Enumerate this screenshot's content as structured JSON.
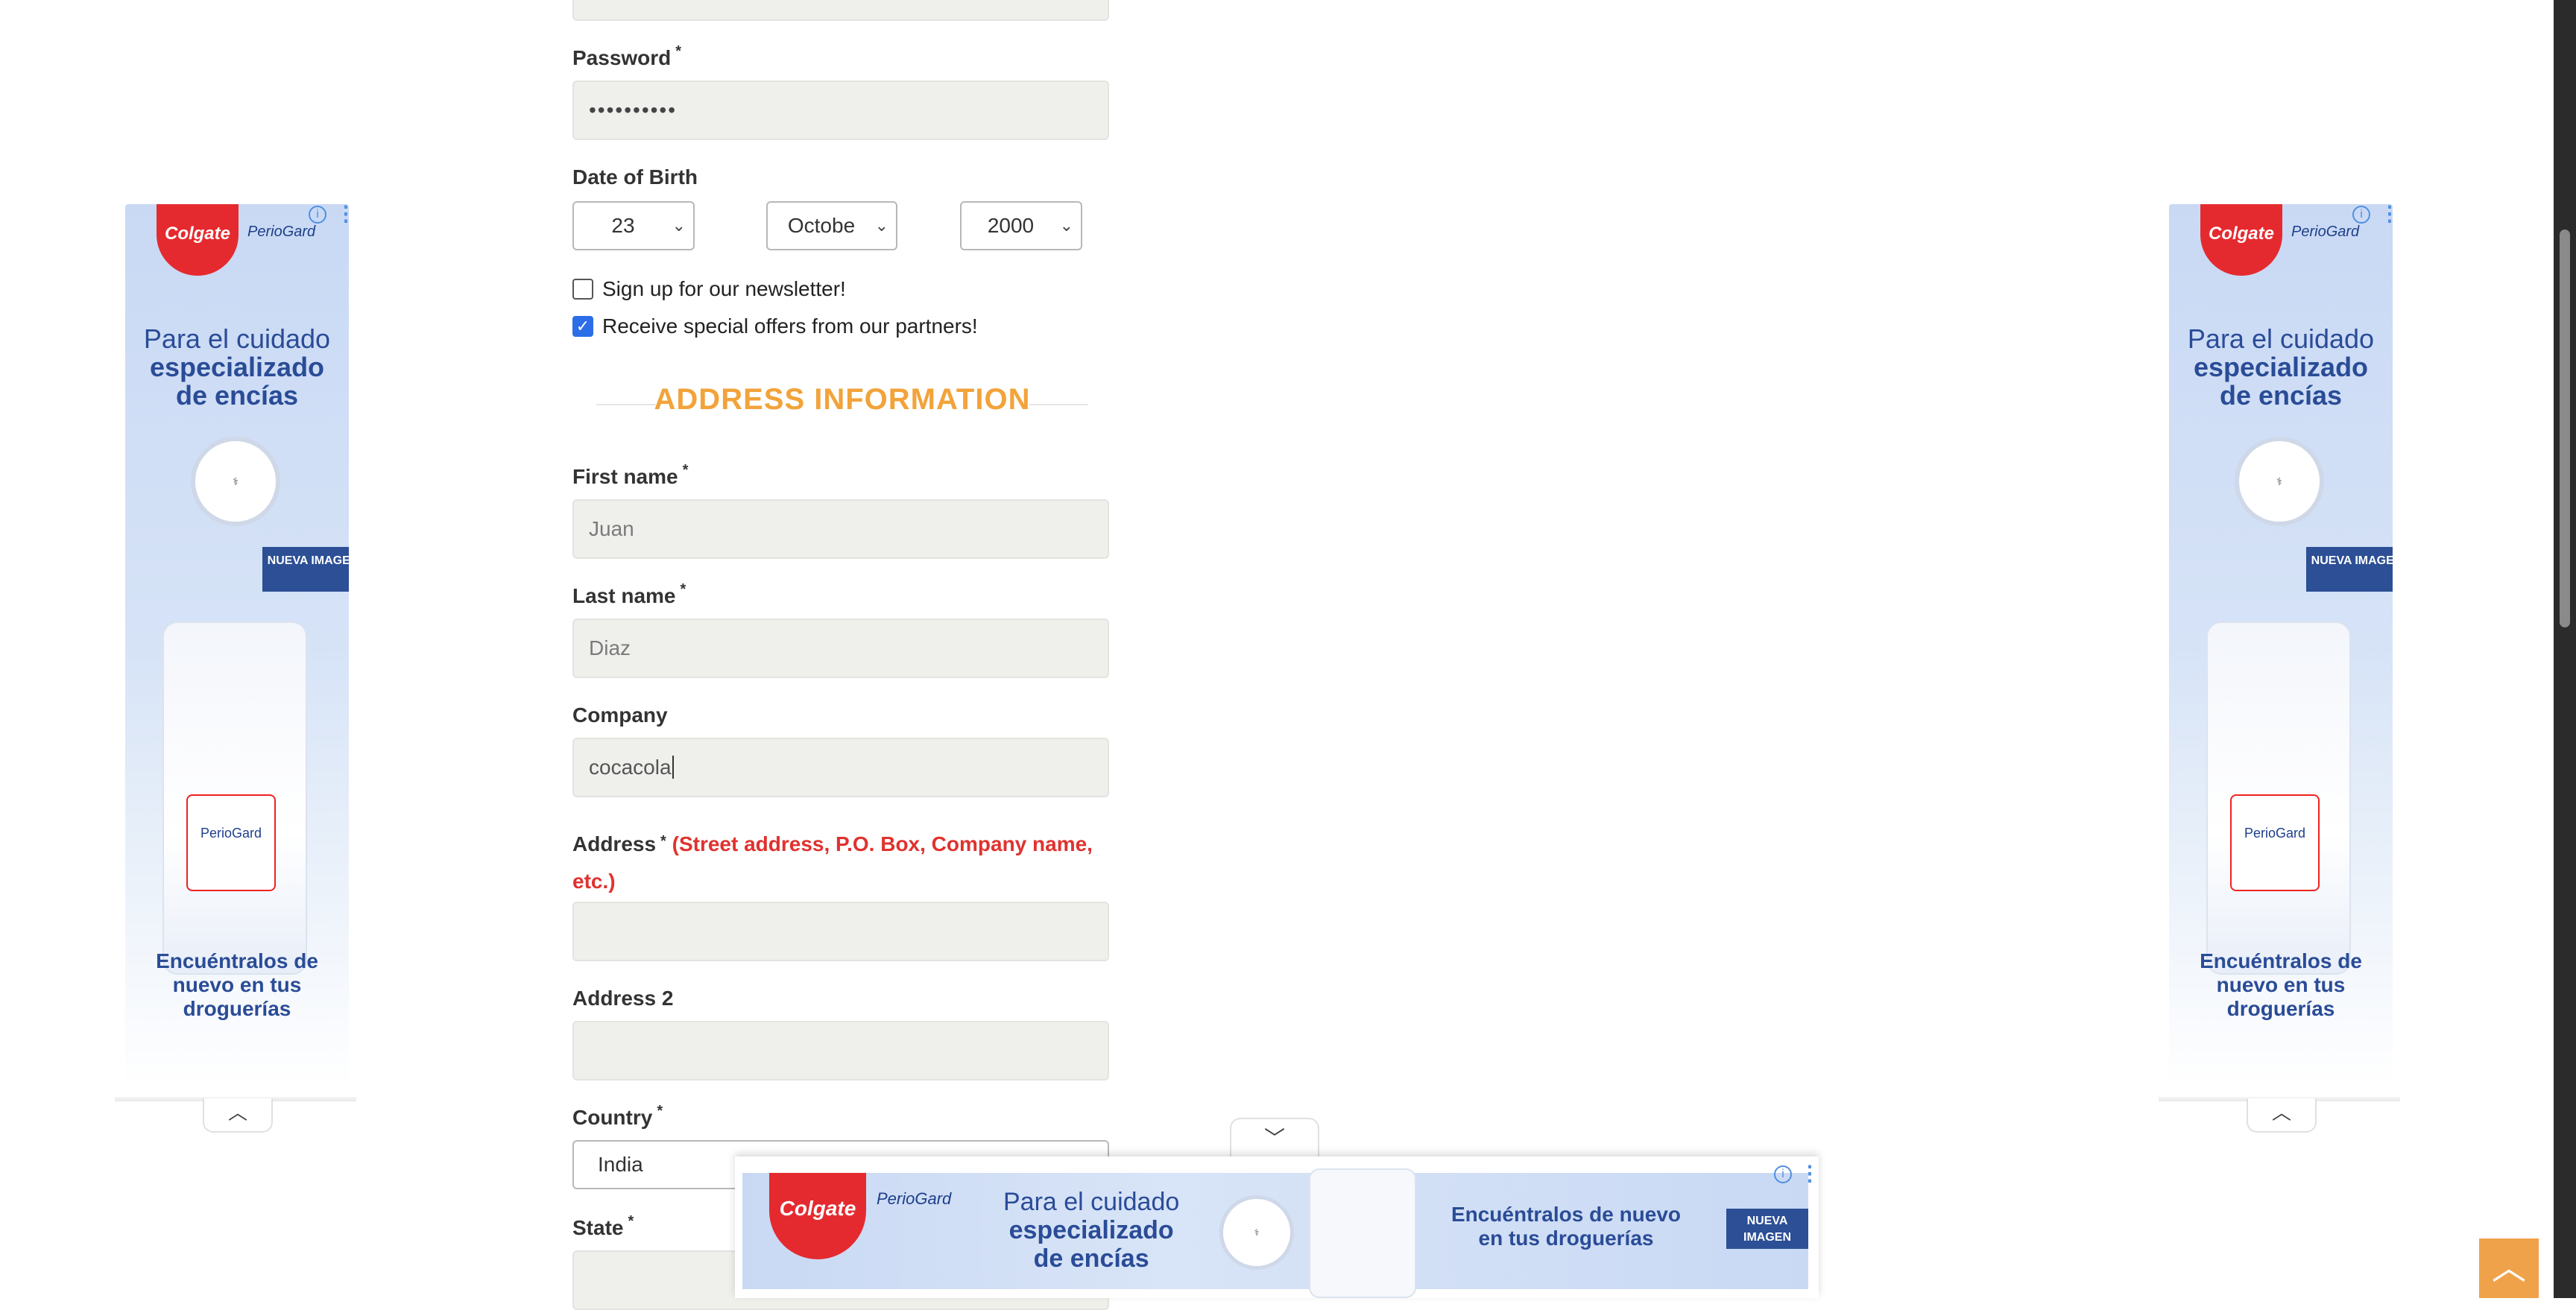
{
  "form": {
    "password": {
      "label": "Password",
      "value": "••••••••••"
    },
    "dob": {
      "label": "Date of Birth",
      "day": "23",
      "month": "Octobe",
      "year": "2000"
    },
    "newsletter": {
      "label": "Sign up for our newsletter!",
      "checked": false
    },
    "offers": {
      "label": "Receive special offers from our partners!",
      "checked": true
    },
    "section_title": "ADDRESS INFORMATION",
    "first_name": {
      "label": "First name",
      "value": "Juan"
    },
    "last_name": {
      "label": "Last name",
      "value": "Diaz"
    },
    "company": {
      "label": "Company",
      "value": "cocacola"
    },
    "address": {
      "label": "Address",
      "hint": "(Street address, P.O. Box, Company name, etc.)",
      "value": ""
    },
    "address2": {
      "label": "Address 2",
      "value": ""
    },
    "country": {
      "label": "Country",
      "value": "India"
    },
    "state": {
      "label": "State",
      "value": ""
    },
    "required_mark": "*"
  },
  "ad": {
    "brand": "Colgate",
    "sub_brand": "PerioGard",
    "headline_1": "Para el cuidado",
    "headline_2": "especializado",
    "headline_3": "de encías",
    "seal": "CLÍNICAMENTE COMPROBADO",
    "tag": "NUEVA IMAGEN",
    "footer": "Encuéntralos de nuevo en tus droguerías",
    "info_icon": "info-icon",
    "menu_icon": "more-vertical-icon",
    "collapse_icon": "chevron-up-icon"
  },
  "bottom_toggle_icon": "chevron-down-icon",
  "scroll_top_icon": "arrow-up-icon",
  "colors": {
    "accent": "#f2a33a",
    "error": "#e0322e",
    "checkbox": "#2c6ee8",
    "brand_red": "#e52a2f",
    "brand_blue": "#2c4f95"
  }
}
